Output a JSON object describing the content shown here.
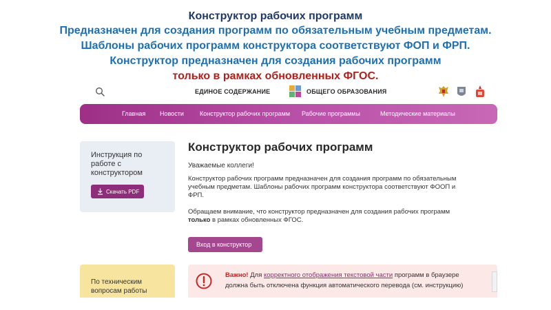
{
  "slide": {
    "heading_line1": "Конструктор рабочих программ",
    "heading_line2": "Предназначен для создания программ по обязательным учебным предметам.",
    "heading_line3": "Шаблоны рабочих программ конструктора  соответствуют ФОП и ФРП.",
    "heading_line4": "Конструктор предназначен для создания рабочих программ",
    "heading_line5": "только в рамках обновленных ФГОС."
  },
  "header": {
    "site_title_part1": "ЕДИНОЕ СОДЕРЖАНИЕ",
    "site_title_part2": "ОБЩЕГО ОБРАЗОВАНИЯ",
    "search_icon": "search-icon",
    "emblems": [
      "coat-of-arms-icon",
      "ministry-emblem-icon",
      "institute-emblem-icon"
    ]
  },
  "nav": {
    "items": [
      "Главная",
      "Новости",
      "Конструктор рабочих программ",
      "Рабочие программы",
      "Методические материалы"
    ]
  },
  "sidebar": {
    "instruction_text": "Инструкция по работе с конструктором",
    "download_label": "Скачать PDF",
    "tech_text": "По техническим вопросам работы"
  },
  "main": {
    "title": "Конструктор рабочих программ",
    "greeting": "Уважаемые коллеги!",
    "para1_line1": "Конструктор рабочих программ предназначен для создания программ по обязательным",
    "para1_line2": "учебным предметам. Шаблоны рабочих программ конструктора  соответствуют ФООП и",
    "para1_line3": "ФРП.",
    "para2_line1": "Обращаем внимание, что  конструктор предназначен для создания рабочих программ",
    "para2_bold": "только",
    "para2_rest": " в рамках обновленных ФГОС.",
    "enter_button": "Вход в конструктор"
  },
  "alert": {
    "important": "Важно!",
    "pre": " Для ",
    "link": "корректного отображения текстовой части",
    "post": " программ в браузере",
    "line2": "должна быть отключена функция автоматического перевода (см. инструкцию)"
  },
  "colors": {
    "nav_gradient_start": "#9d2f86",
    "nav_gradient_end": "#c868b6",
    "button": "#a4478f",
    "heading_dark": "#1f3864",
    "heading_blue": "#1f6fb2",
    "heading_red": "#b0201c",
    "alert_bg": "#fde8e8",
    "tech_card_bg": "#f7e59f"
  }
}
